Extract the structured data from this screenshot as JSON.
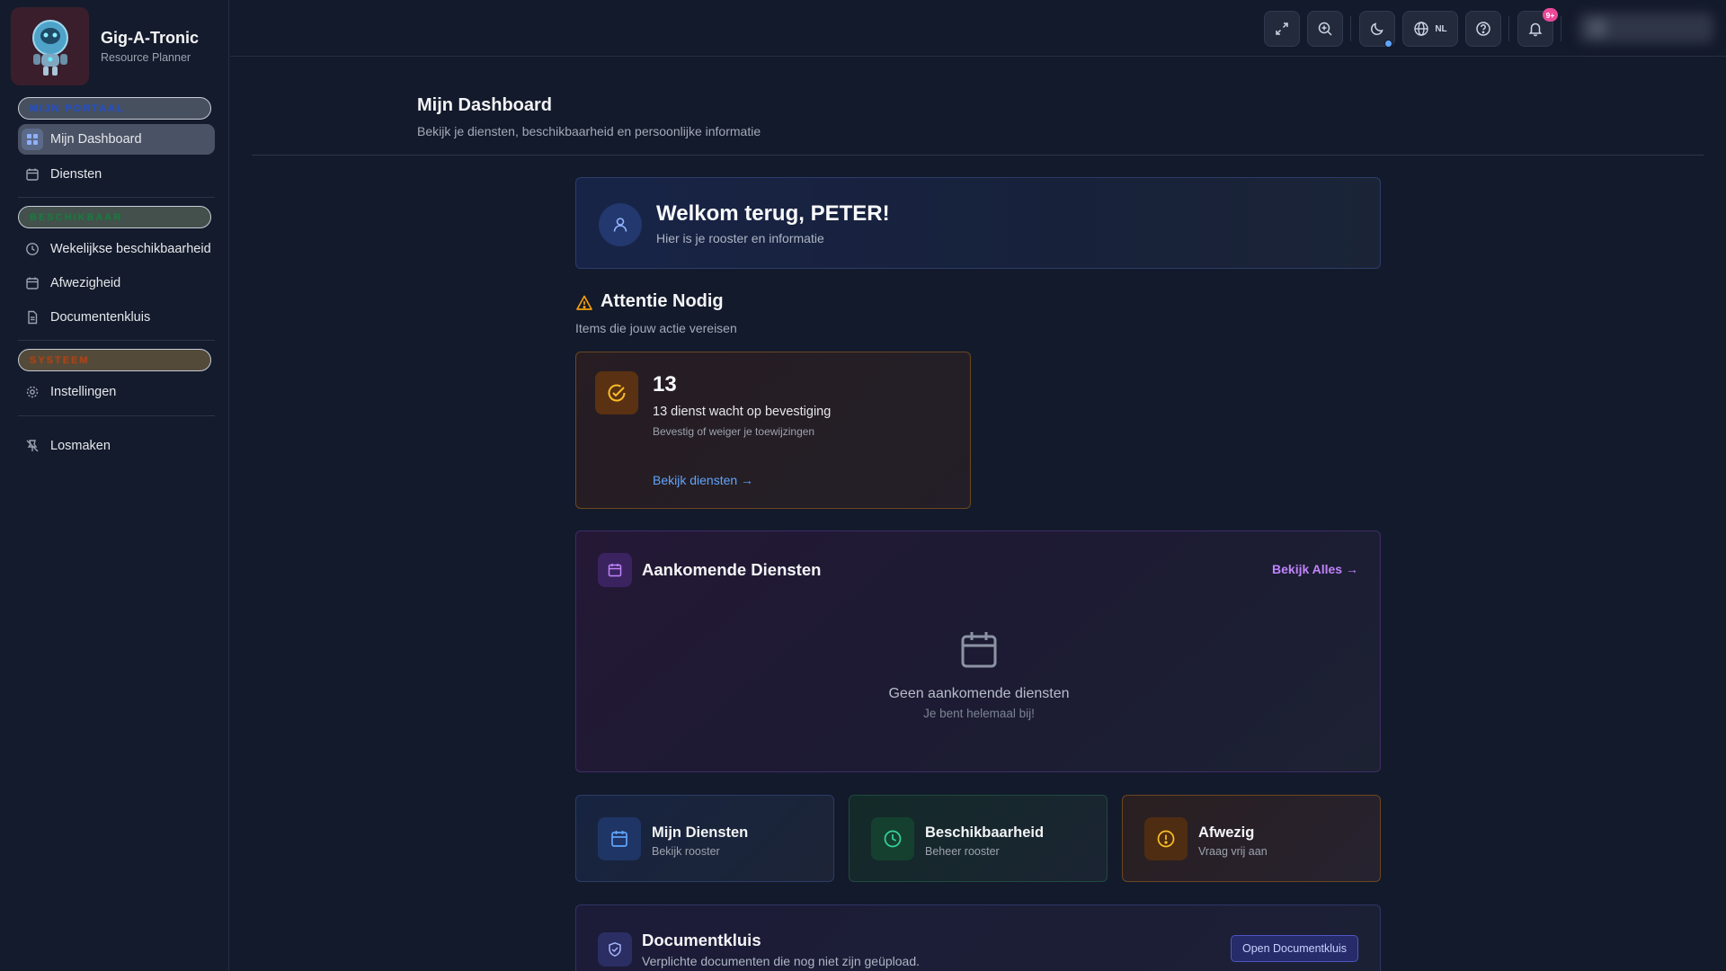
{
  "brand": {
    "title": "Gig-A-Tronic",
    "subtitle": "Resource Planner"
  },
  "sidebar": {
    "sections": [
      {
        "label": "MIJN PORTAAL",
        "color": "#1d4ed8"
      },
      {
        "label": "BESCHIKBAAR",
        "color": "#15803d"
      },
      {
        "label": "SYSTEEM",
        "color": "#c2410c"
      }
    ],
    "items": [
      {
        "label": "Mijn Dashboard",
        "icon": "dashboard-icon",
        "active": true
      },
      {
        "label": "Diensten",
        "icon": "calendar-icon"
      },
      {
        "label": "Wekelijkse beschikbaarheid",
        "icon": "clock-icon"
      },
      {
        "label": "Afwezigheid",
        "icon": "calendar-icon"
      },
      {
        "label": "Documentenkluis",
        "icon": "document-icon"
      },
      {
        "label": "Instellingen",
        "icon": "gear-icon"
      },
      {
        "label": "Losmaken",
        "icon": "unpin-icon"
      }
    ]
  },
  "topbar": {
    "icons": [
      "fullscreen-icon",
      "zoom-in-icon",
      "moon-icon",
      "globe-icon",
      "help-icon",
      "bell-icon"
    ],
    "language": "NL",
    "notification_count": "9+"
  },
  "page": {
    "title": "Mijn Dashboard",
    "subtitle": "Bekijk je diensten, beschikbaarheid en persoonlijke informatie"
  },
  "welcome": {
    "title": "Welkom terug, PETER!",
    "subtitle": "Hier is je rooster en informatie"
  },
  "attention": {
    "title": "Attentie Nodig",
    "subtitle": "Items die jouw actie vereisen",
    "card": {
      "count": "13",
      "text": "13 dienst wacht op bevestiging",
      "hint": "Bevestig of weiger je toewijzingen",
      "link": "Bekijk diensten →"
    }
  },
  "upcoming": {
    "title": "Aankomende Diensten",
    "link": "Bekijk Alles →",
    "empty_title": "Geen aankomende diensten",
    "empty_sub": "Je bent helemaal bij!"
  },
  "quick_actions": [
    {
      "title": "Mijn Diensten",
      "subtitle": "Bekijk rooster",
      "color": "#60a5fa"
    },
    {
      "title": "Beschikbaarheid",
      "subtitle": "Beheer rooster",
      "color": "#34d399"
    },
    {
      "title": "Afwezig",
      "subtitle": "Vraag vrij aan",
      "color": "#fbbf24"
    }
  ],
  "vault": {
    "title": "Documentkluis",
    "subtitle": "Verplichte documenten die nog niet zijn geüpload.",
    "button": "Open Documentkluis"
  },
  "colors": {
    "accent_blue": "#60a5fa",
    "accent_purple": "#c084fc",
    "warning": "#f59e0b",
    "badge": "#ec4899"
  }
}
